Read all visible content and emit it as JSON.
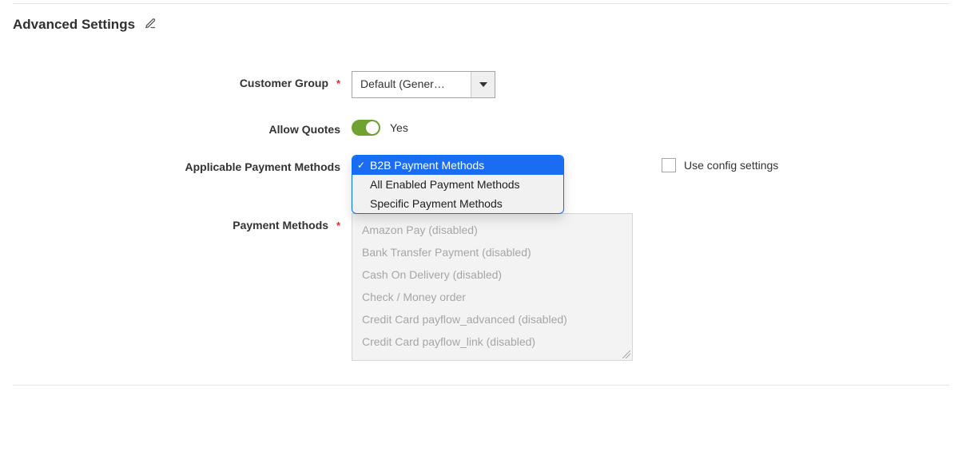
{
  "section": {
    "title": "Advanced Settings"
  },
  "customer_group": {
    "label": "Customer Group",
    "value": "Default (Gener…"
  },
  "allow_quotes": {
    "label": "Allow Quotes",
    "value_label": "Yes"
  },
  "applicable_payment": {
    "label": "Applicable Payment Methods",
    "options": [
      "B2B Payment Methods",
      "All Enabled Payment Methods",
      "Specific Payment Methods"
    ]
  },
  "use_config": {
    "label": "Use config settings"
  },
  "payment_methods": {
    "label": "Payment Methods",
    "options": [
      "Amazon Pay (disabled)",
      "Bank Transfer Payment (disabled)",
      "Cash On Delivery (disabled)",
      "Check / Money order",
      "Credit Card payflow_advanced (disabled)",
      "Credit Card payflow_link (disabled)"
    ]
  }
}
